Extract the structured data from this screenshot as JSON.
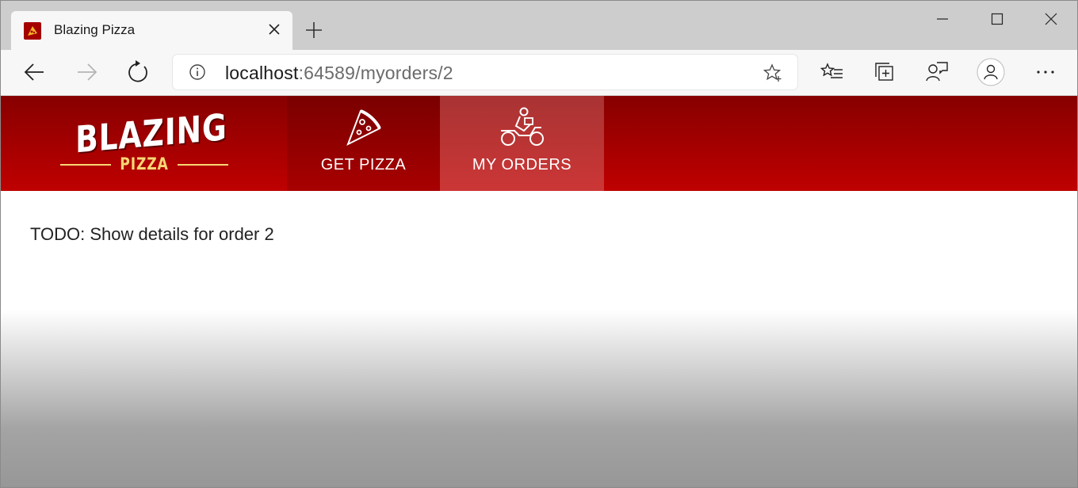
{
  "browser": {
    "tab": {
      "title": "Blazing Pizza",
      "favicon": "pizza-favicon-icon"
    },
    "window_controls": [
      "minimize-icon",
      "maximize-icon",
      "close-icon"
    ],
    "address": {
      "host": "localhost",
      "path": ":64589/myorders/2"
    },
    "toolbar_icons": [
      "back-arrow-icon",
      "forward-arrow-icon",
      "refresh-icon",
      "info-icon",
      "add-favorite-icon",
      "favorites-icon",
      "collections-icon",
      "feedback-icon",
      "profile-icon",
      "more-icon"
    ]
  },
  "app": {
    "logo": {
      "top": "BLAZING",
      "bottom": "PIZZA"
    },
    "nav": [
      {
        "label": "GET PIZZA",
        "icon": "pizza-slice-icon"
      },
      {
        "label": "MY ORDERS",
        "icon": "delivery-scooter-icon"
      }
    ],
    "colors": {
      "header_dark": "#870000",
      "header_light": "#bf0000",
      "active_tab": "#cc3636",
      "logo_accent": "#f7d774"
    }
  },
  "main": {
    "message": "TODO: Show details for order 2"
  }
}
